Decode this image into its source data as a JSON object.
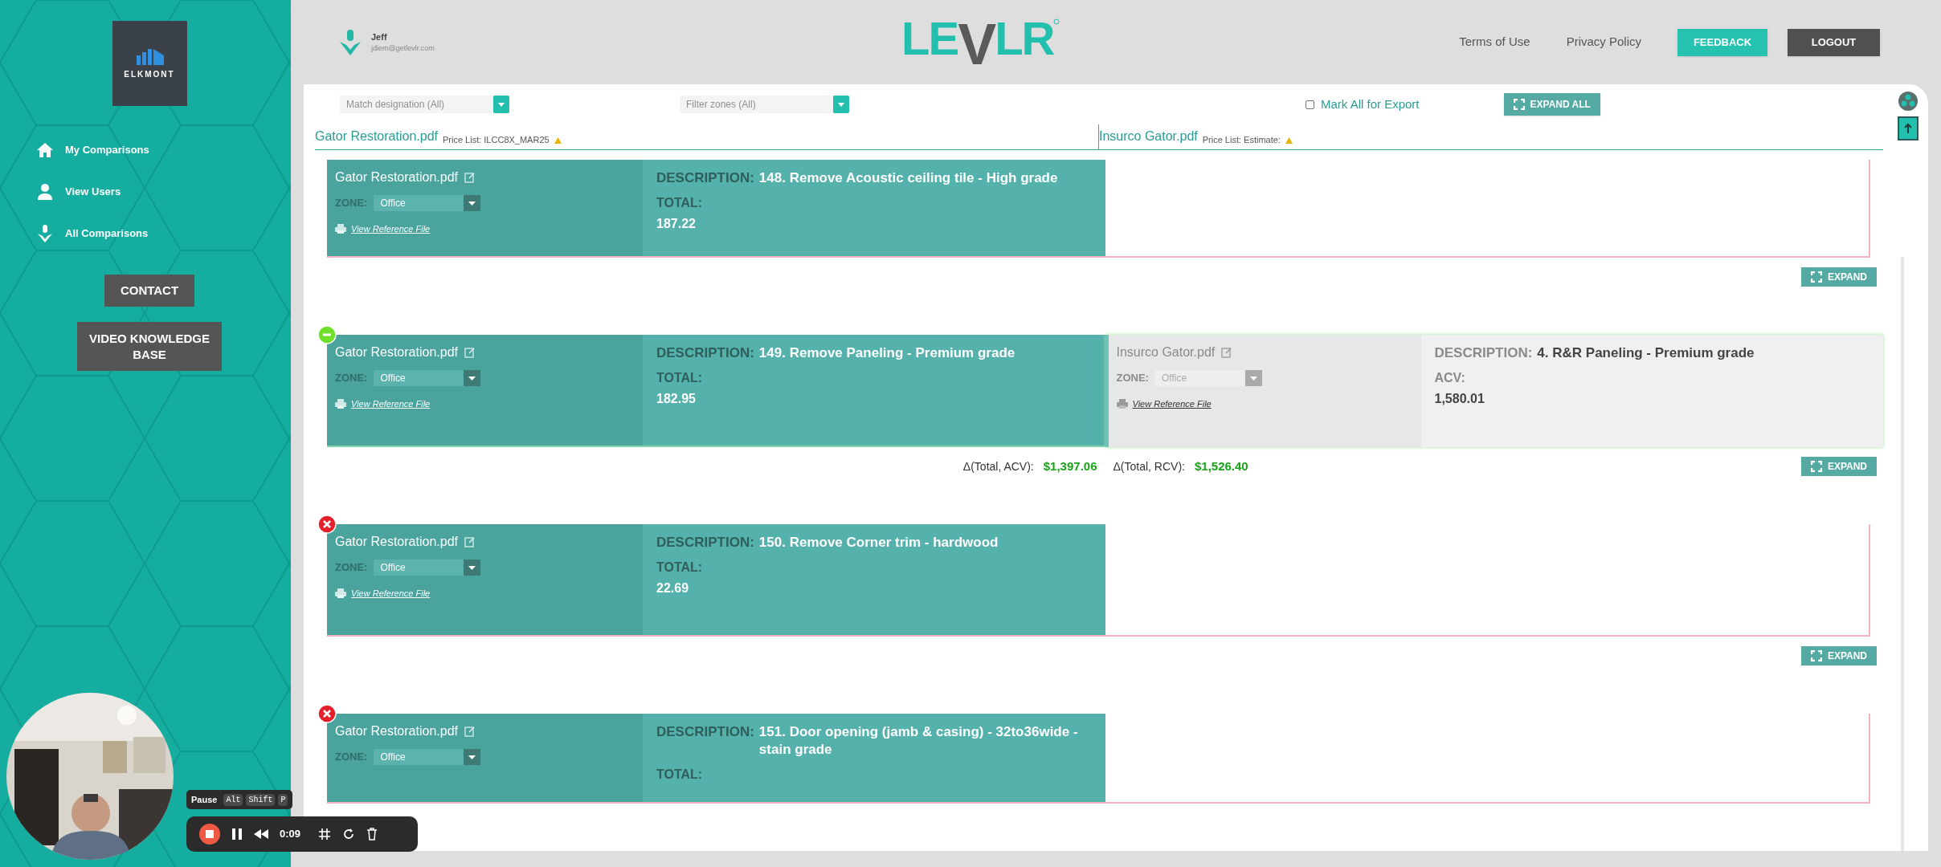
{
  "sidebar": {
    "logo": {
      "wordmark": "ELKMONT"
    },
    "nav": [
      {
        "label": "My Comparisons",
        "kind": "home"
      },
      {
        "label": "View Users",
        "kind": "user"
      },
      {
        "label": "All Comparisons",
        "kind": "agent"
      }
    ],
    "buttons": [
      "CONTACT",
      "VIDEO KNOWLEDGE BASE"
    ]
  },
  "header": {
    "user": {
      "name": "Jeff",
      "email": "jdiem@getlevlr.com"
    },
    "logo": "LEVLR",
    "links": [
      "Terms of Use",
      "Privacy Policy"
    ],
    "feedback": "FEEDBACK",
    "logout": "LOGOUT"
  },
  "toolbar": {
    "filters": [
      {
        "placeholder": "Match designation (All)"
      },
      {
        "placeholder": "Filter zones (All)"
      }
    ],
    "mark_all": {
      "label": "Mark All for Export",
      "checked": false
    },
    "expand_all": "EXPAND ALL"
  },
  "sources": [
    {
      "file": "Gator Restoration.pdf",
      "price_list": "Price List: ILCC8X_MAR25"
    },
    {
      "file": "Insurco Gator.pdf",
      "price_list": "Price List: Estimate:"
    }
  ],
  "items": [
    {
      "left": {
        "file": "Gator Restoration.pdf",
        "zone_label": "ZONE:",
        "zone": "Office",
        "link": "View Reference File",
        "desc_label": "DESCRIPTION:",
        "desc": "148. Remove Acoustic ceiling tile - High grade",
        "value_label": "TOTAL:",
        "value": "187.22"
      },
      "expand": "EXPAND"
    },
    {
      "kind": "partial",
      "left": {
        "file": "Gator Restoration.pdf",
        "zone_label": "ZONE:",
        "zone": "Office",
        "link": "View Reference File",
        "desc_label": "DESCRIPTION:",
        "desc": "149. Remove Paneling - Premium grade",
        "value_label": "TOTAL:",
        "value": "182.95"
      },
      "right": {
        "file": "Insurco Gator.pdf",
        "zone_label": "ZONE:",
        "zone": "Office",
        "link": "View Reference File",
        "desc_label": "DESCRIPTION:",
        "desc": "4. R&R Paneling - Premium grade",
        "value_label": "ACV:",
        "value": "1,580.01"
      },
      "deltas": [
        {
          "label": "Δ(Total, ACV):",
          "value": "$1,397.06"
        },
        {
          "label": "Δ(Total, RCV):",
          "value": "$1,526.40"
        }
      ],
      "expand": "EXPAND"
    },
    {
      "kind": "unmatched",
      "left": {
        "file": "Gator Restoration.pdf",
        "zone_label": "ZONE:",
        "zone": "Office",
        "link": "View Reference File",
        "desc_label": "DESCRIPTION:",
        "desc": "150. Remove Corner trim - hardwood",
        "value_label": "TOTAL:",
        "value": "22.69"
      },
      "expand": "EXPAND"
    },
    {
      "kind": "unmatched",
      "left": {
        "file": "Gator Restoration.pdf",
        "zone_label": "ZONE:",
        "zone": "Office",
        "desc_label": "DESCRIPTION:",
        "desc": "151. Door opening (jamb & casing) - 32to36wide - stain grade",
        "value_label": "TOTAL:"
      }
    }
  ],
  "recorder": {
    "tooltip": [
      "Pause",
      "Alt",
      "Shift",
      "P"
    ],
    "time": "0:09"
  }
}
